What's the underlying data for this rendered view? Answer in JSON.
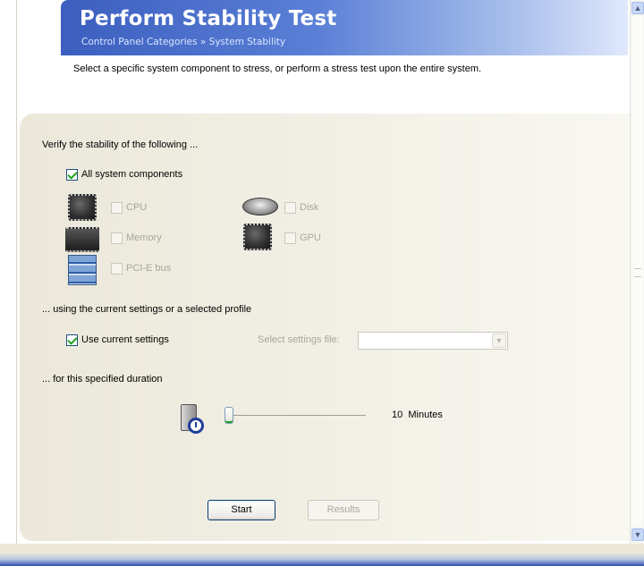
{
  "header": {
    "title": "Perform Stability Test",
    "breadcrumb": "Control Panel Categories » System Stability"
  },
  "intro_text": "Select a specific system component to stress, or perform a stress test upon the entire system.",
  "verify_section": {
    "heading": "Verify the stability of the following ...",
    "all_components": {
      "label": "All system components",
      "checked": true
    },
    "components": [
      {
        "label": "CPU",
        "icon": "cpu-chip-icon",
        "checked": false,
        "enabled": false
      },
      {
        "label": "Memory",
        "icon": "memory-chip-icon",
        "checked": false,
        "enabled": false
      },
      {
        "label": "PCI-E bus",
        "icon": "pcie-bus-icon",
        "checked": false,
        "enabled": false
      },
      {
        "label": "Disk",
        "icon": "disk-drive-icon",
        "checked": false,
        "enabled": false
      },
      {
        "label": "GPU",
        "icon": "gpu-chip-icon",
        "checked": false,
        "enabled": false
      }
    ]
  },
  "settings_section": {
    "heading": "... using the current settings or a selected profile",
    "use_current": {
      "label": "Use current settings",
      "checked": true
    },
    "select_file_label": "Select settings file:",
    "select_file_value": ""
  },
  "duration_section": {
    "heading": "... for this specified duration",
    "value_text": "10  Minutes",
    "slider_fraction": 0.0
  },
  "buttons": {
    "start": "Start",
    "results": "Results"
  },
  "scrollbar": {
    "up": "▲",
    "down": "▼"
  },
  "combo_arrow": "▼",
  "colors": {
    "banner_start": "#3c5fbf",
    "banner_end": "#dfe8fb",
    "disabled_text": "#a7a69b",
    "check_green": "#21a121",
    "panel_bg": "#ebe8da"
  }
}
